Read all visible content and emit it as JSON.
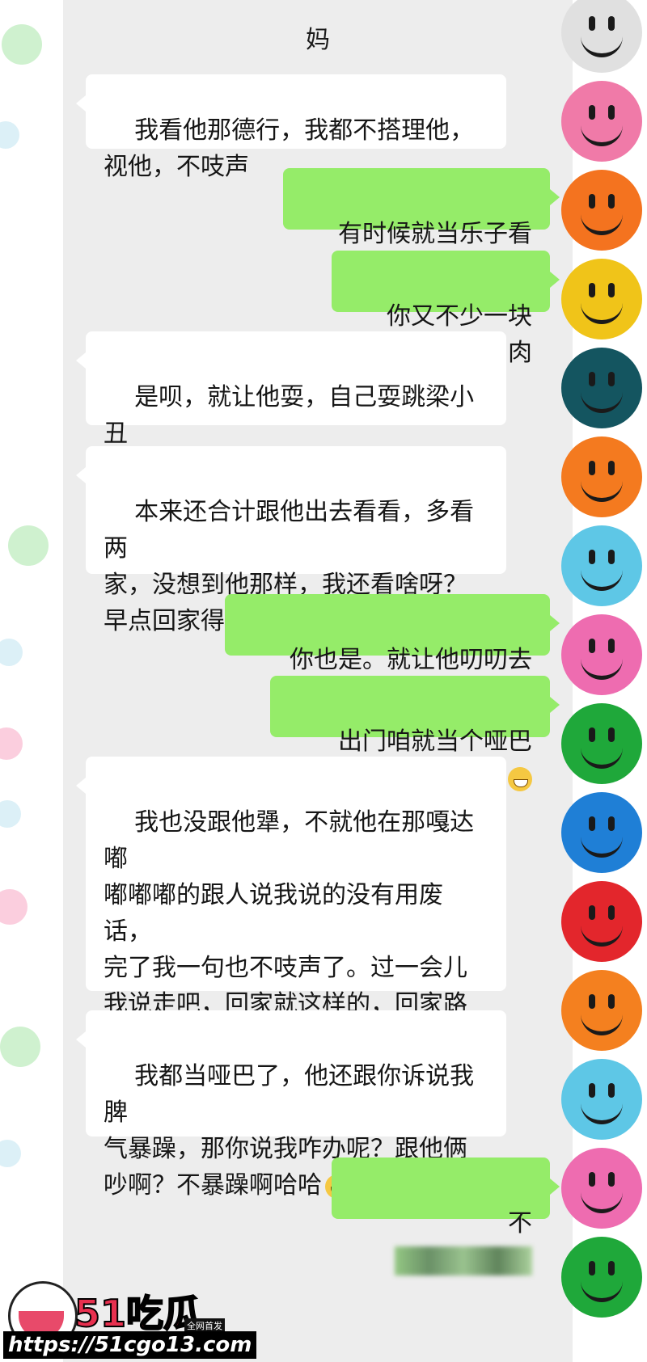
{
  "header": {
    "title": "妈"
  },
  "messages": [
    {
      "side": "in",
      "text": "我看他那德行，我都不搭理他，\n视他，不吱声"
    },
    {
      "side": "out",
      "text": "有时候就当乐子看呗"
    },
    {
      "side": "out",
      "text": "你又不少一块肉"
    },
    {
      "side": "in",
      "text": "是呗，就让他耍，自己耍跳梁小丑\n似的，他自己考虑去"
    },
    {
      "side": "in",
      "text": "本来还合计跟他出去看看，多看两\n家，没想到他那样，我还看啥呀？\n早点回家得了，省着生气"
    },
    {
      "side": "out",
      "text": "你也是。就让他叨叨去呗"
    },
    {
      "side": "out",
      "text": "出门咱就当个哑巴",
      "emoji": "grin-emoji"
    },
    {
      "side": "in",
      "text": "我也没跟他犟，不就他在那嘎达嘟\n嘟嘟嘟的跟人说我说的没有用废话，\n完了我一句也不吱声了。过一会儿\n我说走吧，回家就这样的，回家路\n上我一句也没跟他说话。到路口我\n就说下车，也没搭理他呀"
    },
    {
      "side": "in",
      "text": "我都当哑巴了，他还跟你诉说我脾\n气暴躁，那你说我咋办呢？跟他俩\n吵啊？不暴躁啊哈哈",
      "emoji": "laugh-emoji"
    },
    {
      "side": "out",
      "text": "不",
      "blurred": true
    }
  ],
  "watermark": {
    "brand": "51吃瓜",
    "tag": "全网首发",
    "url": "https://51cgo13.com"
  },
  "smiley_colors": [
    "#e0e0e0",
    "#f07aa8",
    "#f4731f",
    "#f0c419",
    "#145560",
    "#f47a1f",
    "#5ec7e6",
    "#ee6cb0",
    "#1fa83a",
    "#1f7fd6",
    "#e3262c",
    "#f4801f",
    "#5ec7e6",
    "#ee6cb0",
    "#1fa83a"
  ],
  "colors": {
    "outgoing": "#95ec69",
    "incoming": "#ffffff",
    "background": "#ededed"
  }
}
